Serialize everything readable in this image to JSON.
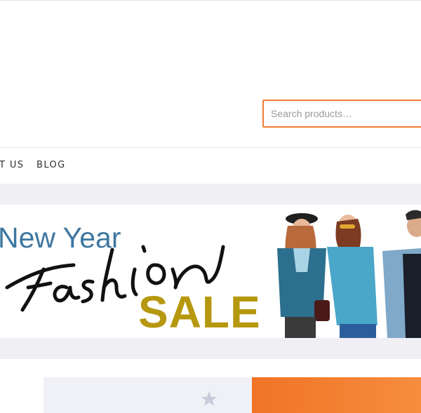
{
  "search": {
    "placeholder": "Search products…"
  },
  "nav": {
    "items": [
      {
        "label": "T US"
      },
      {
        "label": "BLOG"
      }
    ]
  },
  "banner": {
    "line1": "New Year",
    "line2": "Fashion",
    "line3": "SALE"
  },
  "colors": {
    "accent": "#f07c35",
    "banner_blue": "#3e77a0",
    "sale_gold": "#b6980f",
    "band_grey": "#efeff4"
  }
}
